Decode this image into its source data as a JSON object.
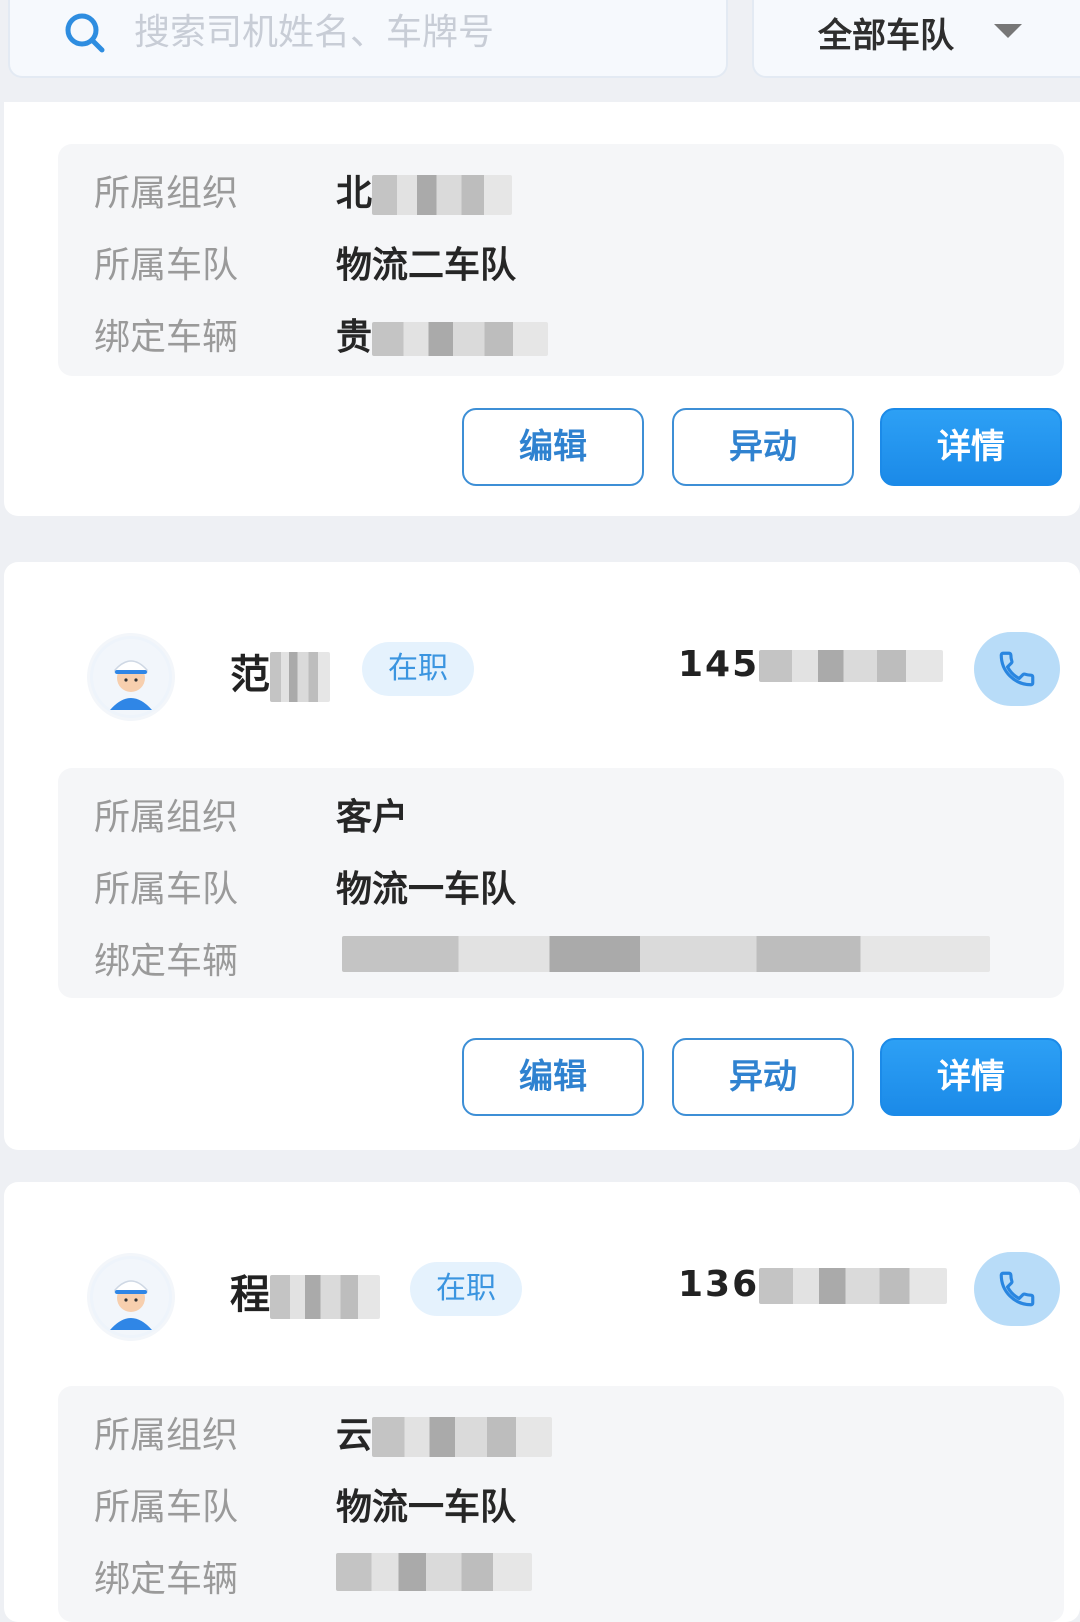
{
  "search": {
    "placeholder": "搜索司机姓名、车牌号"
  },
  "filter": {
    "selected": "全部车队"
  },
  "field_labels": {
    "org": "所属组织",
    "fleet": "所属车队",
    "vehicle": "绑定车辆"
  },
  "actions": {
    "edit": "编辑",
    "transfer": "异动",
    "details": "详情"
  },
  "drivers": [
    {
      "name_visible": "",
      "status": "",
      "phone_visible": "",
      "org_visible": "北",
      "fleet": "物流二车队",
      "vehicle_visible": "贵"
    },
    {
      "name_visible": "范",
      "status": "在职",
      "phone_visible": "145",
      "org_visible": "客户",
      "fleet": "物流一车队",
      "vehicle_visible": ""
    },
    {
      "name_visible": "程",
      "status": "在职",
      "phone_visible": "136",
      "org_visible": "云",
      "fleet": "物流一车队",
      "vehicle_visible": ""
    }
  ],
  "colors": {
    "accent": "#1b8ae8",
    "badge_bg": "#e5f2fd",
    "page_bg": "#eef0f4"
  }
}
